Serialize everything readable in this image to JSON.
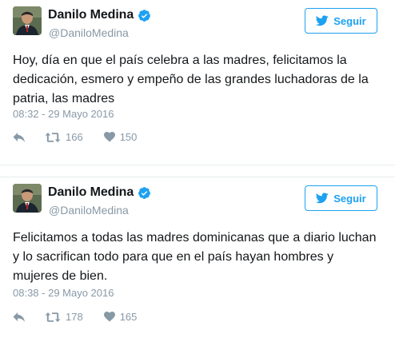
{
  "tweets": [
    {
      "author": {
        "display_name": "Danilo Medina",
        "screen_name": "@DaniloMedina",
        "verified": true
      },
      "follow_label": "Seguir",
      "text": "Hoy, día en que el país celebra a las madres, felicitamos la dedicación, esmero y empeño de las grandes luchadoras de la patria, las madres",
      "timestamp": "08:32 - 29 Mayo 2016",
      "retweets": "166",
      "likes": "150"
    },
    {
      "author": {
        "display_name": "Danilo Medina",
        "screen_name": "@DaniloMedina",
        "verified": true
      },
      "follow_label": "Seguir",
      "text": "Felicitamos a todas las madres dominicanas que a diario luchan y lo sacrifican todo para que en el país hayan hombres y mujeres de bien.",
      "timestamp": "08:38 - 29 Mayo 2016",
      "retweets": "178",
      "likes": "165"
    }
  ],
  "icons": {
    "verified": "verified-badge-icon",
    "follow": "twitter-bird-icon",
    "reply": "reply-icon",
    "retweet": "retweet-icon",
    "like": "heart-icon"
  },
  "colors": {
    "accent": "#1da1f2",
    "text": "#14171a",
    "muted": "#8899a6",
    "divider": "#e6ecf0"
  }
}
